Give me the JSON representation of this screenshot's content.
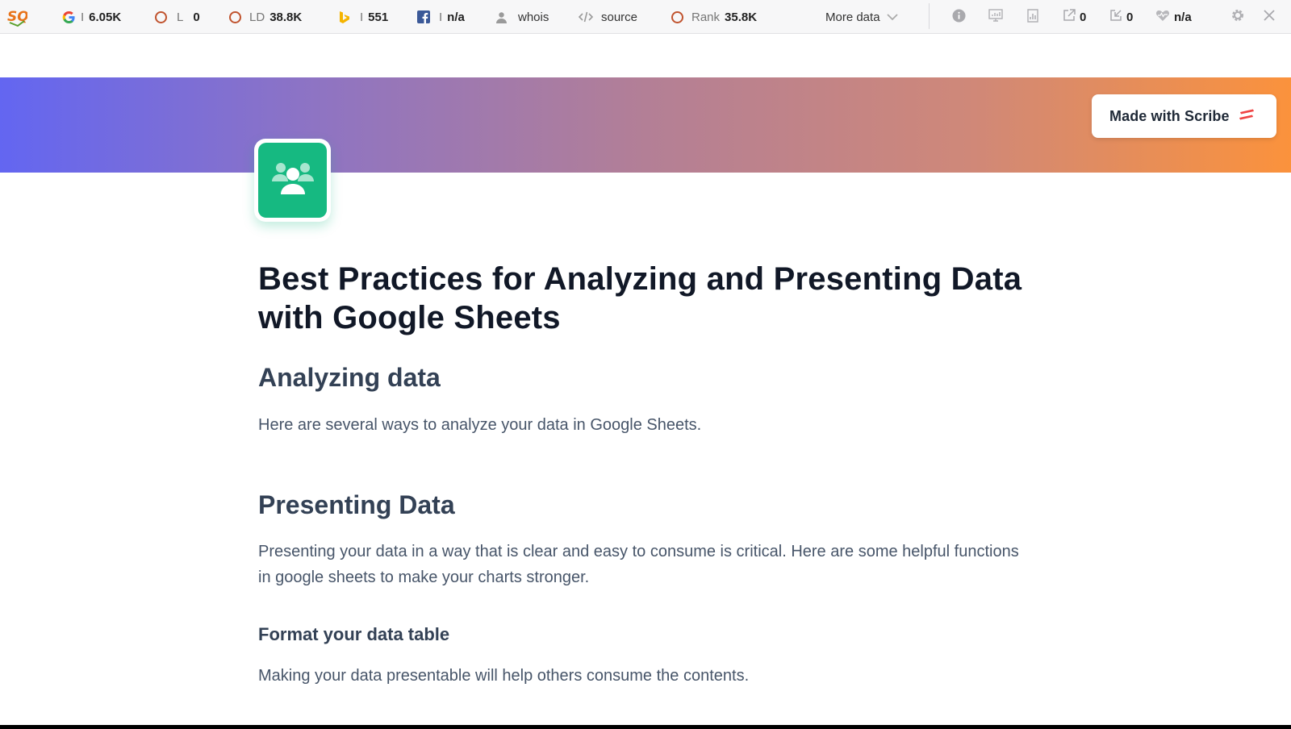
{
  "seobar": {
    "logo_text": "SQ",
    "google": {
      "prefix": "I",
      "value": "6.05K"
    },
    "l": {
      "prefix": "L",
      "value": "0"
    },
    "ld": {
      "prefix": "LD",
      "value": "38.8K"
    },
    "bing": {
      "prefix": "I",
      "value": "551"
    },
    "facebook": {
      "prefix": "I",
      "value": "n/a"
    },
    "whois_label": "whois",
    "source_label": "source",
    "rank": {
      "prefix": "Rank",
      "value": "35.8K"
    },
    "more_data_label": "More data",
    "external_links": "0",
    "internal_links": "0",
    "health": "n/a"
  },
  "banner": {
    "scribe_label": "Made with Scribe"
  },
  "content": {
    "title": "Best Practices for Analyzing and Presenting Data with Google Sheets",
    "section1_heading": "Analyzing data",
    "section1_body": "Here are several ways to analyze your data in Google Sheets.",
    "section2_heading": "Presenting Data",
    "section2_body": "Presenting your data in a way that is clear and easy to consume is critical. Here are some helpful functions in google sheets to make your charts stronger.",
    "sub_heading": "Format your data table",
    "sub_body": "Making your data presentable will help others consume the contents."
  },
  "colors": {
    "banner_start": "#6366f1",
    "banner_end": "#fb923c",
    "avatar_green": "#16b981",
    "scribe_red": "#ef4444"
  },
  "icons": [
    "seoquake-logo-icon",
    "google-icon",
    "ring-icon",
    "bing-icon",
    "facebook-icon",
    "user-icon",
    "code-icon",
    "chevron-down-icon",
    "info-icon",
    "density-icon",
    "diagnosis-icon",
    "external-link-icon",
    "internal-link-icon",
    "heart-icon",
    "gear-icon",
    "close-icon",
    "users-icon",
    "scribe-logo-icon"
  ]
}
